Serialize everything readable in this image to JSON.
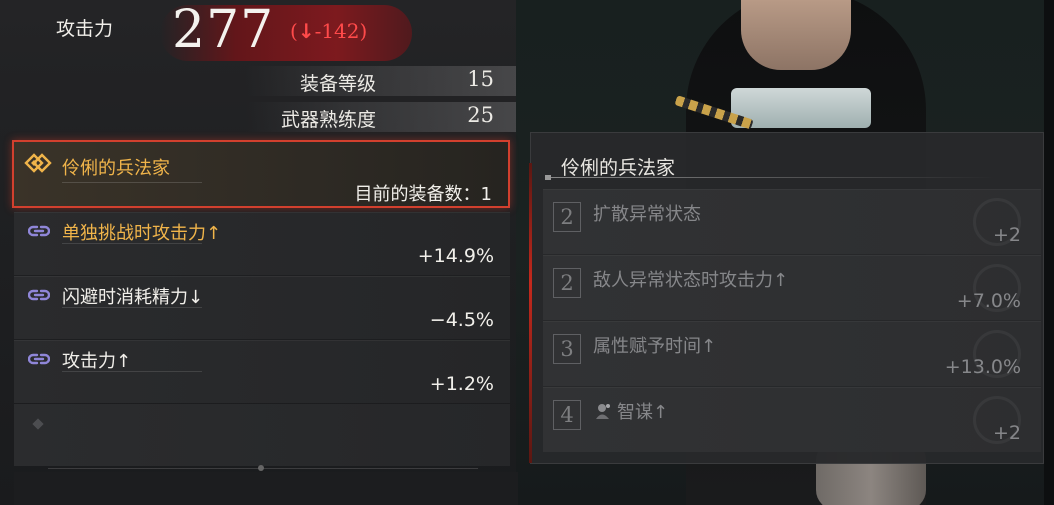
{
  "header": {
    "attack_label": "攻击力",
    "attack_value": "277",
    "change_open": "(",
    "change_arrow": "↓",
    "change_value": "-142)"
  },
  "stats": [
    {
      "label": "装备等级",
      "value": "15"
    },
    {
      "label": "武器熟练度",
      "value": "25"
    }
  ],
  "set": {
    "name": "伶俐的兵法家",
    "count_text": "目前的装备数：1"
  },
  "effects": [
    {
      "label": "单独挑战时攻击力↑",
      "value": "+14.9%",
      "active": true
    },
    {
      "label": "闪避时消耗精力↓",
      "value": "−4.5%",
      "active": false
    },
    {
      "label": "攻击力↑",
      "value": "+1.2%",
      "active": false
    }
  ],
  "detail": {
    "title": "伶俐的兵法家",
    "tiers": [
      {
        "num": "2",
        "label": "扩散异常状态",
        "value": "+2"
      },
      {
        "num": "2",
        "label": "敌人异常状态时攻击力↑",
        "value": "+7.0%"
      },
      {
        "num": "3",
        "label": "属性赋予时间↑",
        "value": "+13.0%"
      },
      {
        "num": "4",
        "label": "智谋↑",
        "value": "+2",
        "icon": "spirit-icon"
      }
    ]
  },
  "colors": {
    "active_orange": "#f0b44a",
    "selected_border": "#d2402e",
    "decrease_red": "#ff4a4a",
    "link_icon": "#8f86d8"
  }
}
